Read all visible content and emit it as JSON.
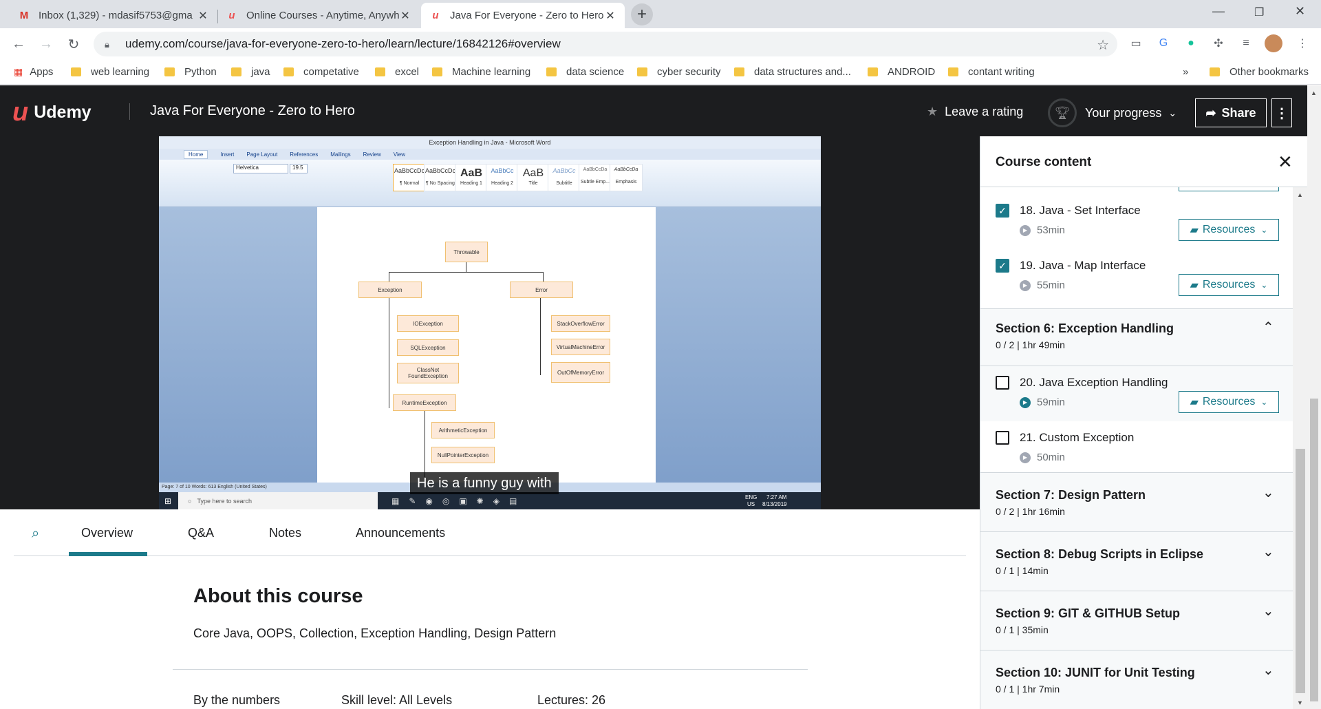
{
  "browser": {
    "tabs": [
      {
        "title": "Inbox (1,329) - mdasif5753@gma",
        "icon": "gmail-icon"
      },
      {
        "title": "Online Courses - Anytime, Anywh",
        "icon": "udemy-icon"
      },
      {
        "title": "Java For Everyone - Zero to Hero",
        "icon": "udemy-icon"
      }
    ],
    "url": "udemy.com/course/java-for-everyone-zero-to-hero/learn/lecture/16842126#overview",
    "bookmarks": [
      "Apps",
      "web learning",
      "Python",
      "java",
      "competative",
      "excel",
      "Machine learning",
      "data science",
      "cyber security",
      "data structures and...",
      "ANDROID",
      "contant writing",
      "Other bookmarks"
    ],
    "more_bookmarks": "»"
  },
  "header": {
    "logo": "Udemy",
    "course_title": "Java For Everyone - Zero to Hero",
    "rating_label": "Leave a rating",
    "progress_label": "Your progress",
    "share_label": "Share"
  },
  "video": {
    "caption": "He is a funny guy with",
    "word": {
      "title": "Exception Handling in Java - Microsoft Word",
      "tabs": [
        "Home",
        "Insert",
        "Page Layout",
        "References",
        "Mailings",
        "Review",
        "View"
      ],
      "font": "Helvetica",
      "size": "19.5",
      "styles": [
        "AaBbCcDc",
        "AaBbCcDc",
        "AaB",
        "AaBbCc",
        "AaB",
        "AaBbCc",
        "AaBbCcDa",
        "AaBbCcDa"
      ],
      "style_names": [
        "¶ Normal",
        "¶ No Spacing",
        "Heading 1",
        "Heading 2",
        "Title",
        "Subtitle",
        "Subtle Emp...",
        "Emphasis"
      ],
      "status": "Page: 7 of 10   Words: 613   English (United States)",
      "search_placeholder": "Type here to search",
      "time": "7:27 AM",
      "date": "8/13/2019",
      "lang": "ENG",
      "region": "US"
    },
    "diagram": {
      "root": "Throwable",
      "exception": "Exception",
      "error": "Error",
      "io": "IOException",
      "sql": "SQLException",
      "cnf": "ClassNot FoundException",
      "runtime": "RuntimeException",
      "arith": "ArithmeticException",
      "npe": "NullPointerException",
      "so": "StackOverflowError",
      "vm": "VirtualMachineError",
      "oom": "OutOfMemoryError"
    }
  },
  "content_tabs": [
    "Overview",
    "Q&A",
    "Notes",
    "Announcements"
  ],
  "about": {
    "title": "About this course",
    "description": "Core Java, OOPS, Collection, Exception Handling, Design Pattern",
    "by_numbers": "By the numbers",
    "skill": "Skill level: All Levels",
    "lectures": "Lectures: 26"
  },
  "sidebar": {
    "title": "Course content",
    "resources_label": "Resources",
    "lectures": [
      {
        "title": "18. Java - Set Interface",
        "duration": "53min",
        "checked": true
      },
      {
        "title": "19. Java - Map Interface",
        "duration": "55min",
        "checked": true
      },
      {
        "title": "20. Java Exception Handling",
        "duration": "59min",
        "checked": false
      },
      {
        "title": "21. Custom Exception",
        "duration": "50min",
        "checked": false
      }
    ],
    "sections": [
      {
        "title": "Section 6: Exception Handling",
        "sub": "0 / 2 | 1hr 49min"
      },
      {
        "title": "Section 7: Design Pattern",
        "sub": "0 / 2 | 1hr 16min"
      },
      {
        "title": "Section 8: Debug Scripts in Eclipse",
        "sub": "0 / 1 | 14min"
      },
      {
        "title": "Section 9: GIT & GITHUB Setup",
        "sub": "0 / 1 | 35min"
      },
      {
        "title": "Section 10: JUNIT for Unit Testing",
        "sub": "0 / 1 | 1hr 7min"
      }
    ]
  }
}
